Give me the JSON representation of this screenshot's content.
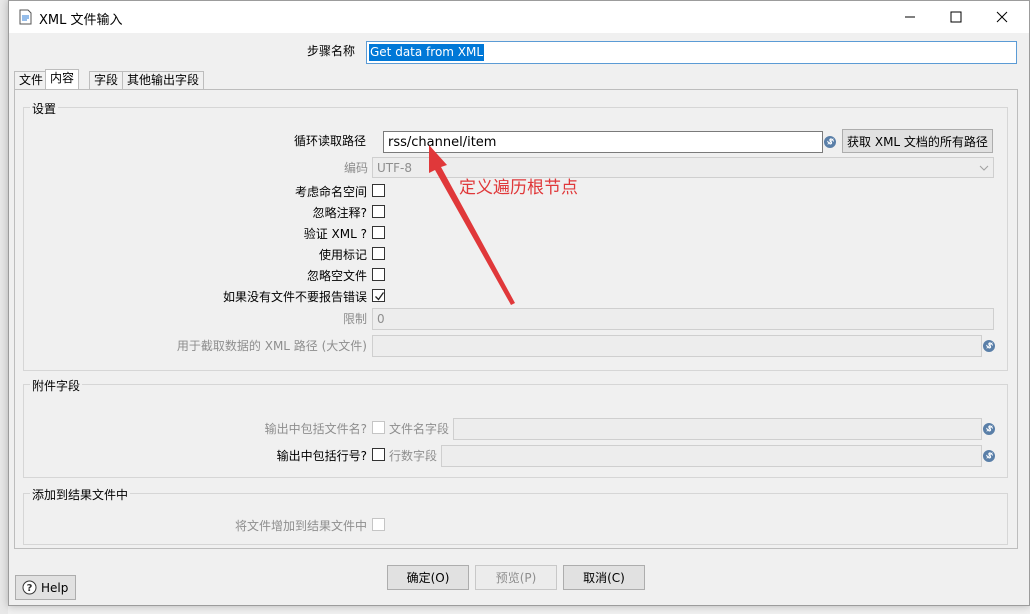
{
  "window": {
    "title": "XML 文件输入"
  },
  "step_name": {
    "label": "步骤名称",
    "value": "Get data from XML"
  },
  "tabs": [
    "文件",
    "内容",
    "字段",
    "其他输出字段"
  ],
  "settings": {
    "title": "设置",
    "loop_path_label": "循环读取路径",
    "loop_path_value": "rss/channel/item",
    "get_paths_button": "获取 XML 文档的所有路径",
    "encoding_label": "编码",
    "encoding_value": "UTF-8",
    "namespace_label": "考虑命名空间",
    "ignore_comments_label": "忽略注释?",
    "validate_xml_label": "验证 XML ?",
    "use_token_label": "使用标记",
    "ignore_empty_label": "忽略空文件",
    "no_error_label": "如果没有文件不要报告错误",
    "limit_label": "限制",
    "limit_value": "0",
    "prune_path_label": "用于截取数据的 XML 路径 (大文件)",
    "prune_path_value": ""
  },
  "additional_fields": {
    "title": "附件字段",
    "include_filename_label": "输出中包括文件名?",
    "filename_field_label": "文件名字段",
    "include_rownum_label": "输出中包括行号?",
    "rownum_field_label": "行数字段"
  },
  "result_files": {
    "title": "添加到结果文件中",
    "add_files_label": "将文件增加到结果文件中"
  },
  "buttons": {
    "ok": "确定(O)",
    "preview": "预览(P)",
    "cancel": "取消(C)",
    "help": "Help"
  },
  "annotation": {
    "text": "定义遍历根节点",
    "color": "#e0383a"
  },
  "colors": {
    "selection": "#0078d7",
    "variable_icon": "#5a7fa8"
  }
}
